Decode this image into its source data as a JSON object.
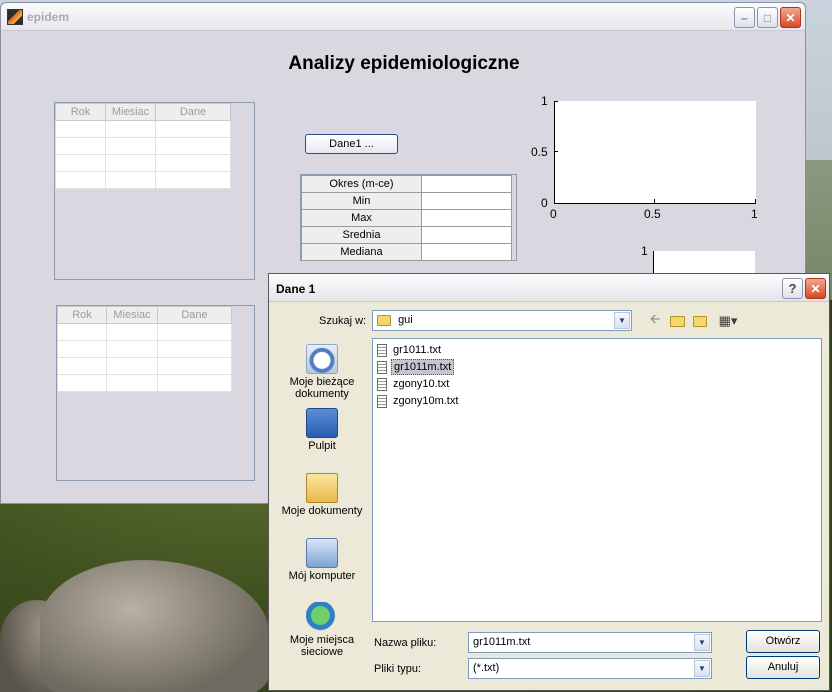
{
  "main_window": {
    "title": "epidem",
    "figure_title": "Analizy epidemiologiczne",
    "table1": {
      "headers": [
        "Rok",
        "Miesiac",
        "Dane"
      ],
      "rows": [
        [
          "",
          "",
          ""
        ],
        [
          "",
          "",
          ""
        ],
        [
          "",
          "",
          ""
        ],
        [
          "",
          "",
          ""
        ]
      ]
    },
    "table2": {
      "headers": [
        "Rok",
        "Miesiac",
        "Dane"
      ],
      "rows": [
        [
          "",
          "",
          ""
        ],
        [
          "",
          "",
          ""
        ],
        [
          "",
          "",
          ""
        ],
        [
          "",
          "",
          ""
        ]
      ]
    },
    "dane1_button": "Dane1 ...",
    "stats": [
      {
        "label": "Okres (m-ce)",
        "value": ""
      },
      {
        "label": "Min",
        "value": ""
      },
      {
        "label": "Max",
        "value": ""
      },
      {
        "label": "Srednia",
        "value": ""
      },
      {
        "label": "Mediana",
        "value": ""
      }
    ],
    "axes1": {
      "y_ticks": [
        "1",
        "0.5",
        "0"
      ],
      "x_ticks": [
        "0",
        "0.5",
        "1"
      ]
    },
    "axes2": {
      "y_ticks": [
        "1"
      ]
    }
  },
  "dialog": {
    "title": "Dane 1",
    "look_in_label": "Szukaj w:",
    "look_in_value": "gui",
    "places": [
      {
        "label": "Moje bieżące dokumenty",
        "icon": "recent-documents-icon"
      },
      {
        "label": "Pulpit",
        "icon": "desktop-icon"
      },
      {
        "label": "Moje dokumenty",
        "icon": "my-documents-icon"
      },
      {
        "label": "Mój komputer",
        "icon": "my-computer-icon"
      },
      {
        "label": "Moje miejsca sieciowe",
        "icon": "network-places-icon"
      }
    ],
    "files": [
      "gr1011.txt",
      "gr1011m.txt",
      "zgony10.txt",
      "zgony10m.txt"
    ],
    "selected_file": "gr1011m.txt",
    "filename_label": "Nazwa pliku:",
    "filename_value": "gr1011m.txt",
    "filetype_label": "Pliki typu:",
    "filetype_value": "(*.txt)",
    "open_button": "Otwórz",
    "cancel_button": "Anuluj"
  }
}
